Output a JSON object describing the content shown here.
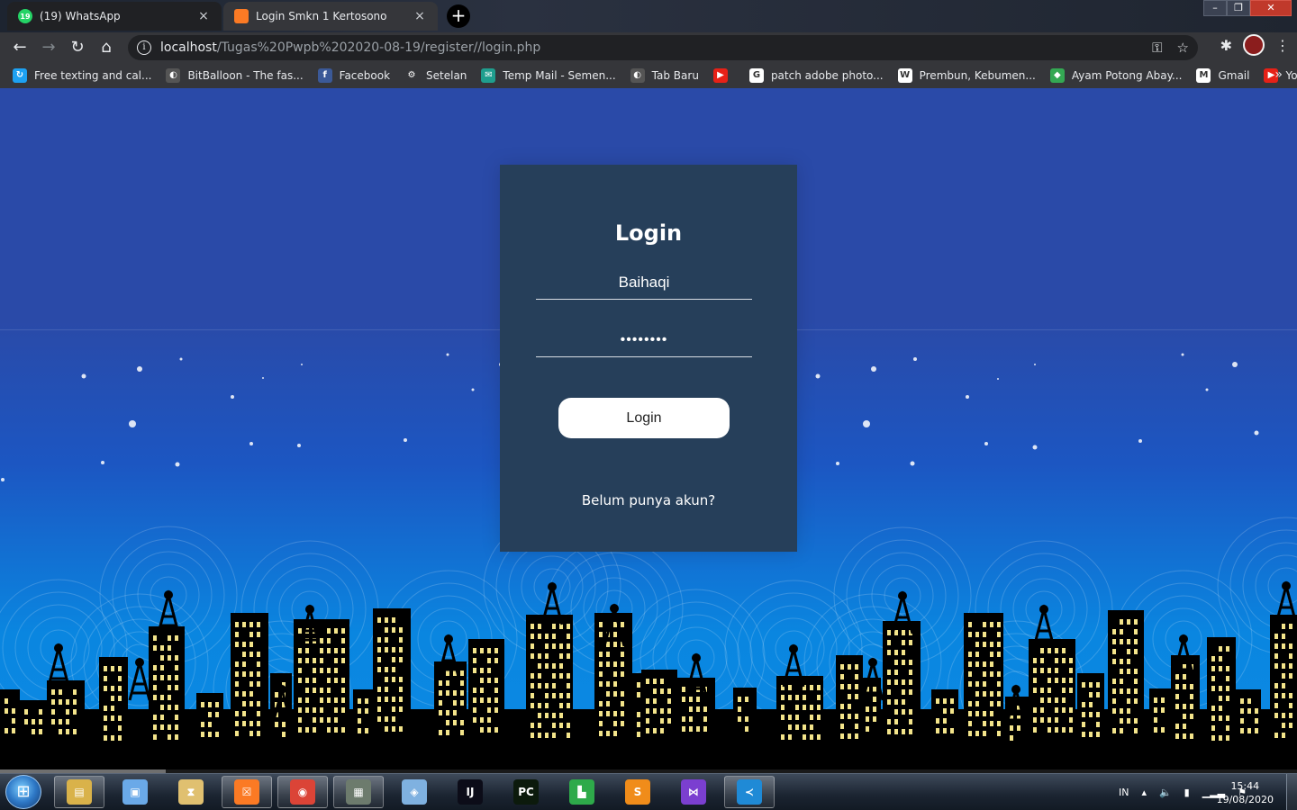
{
  "tabs": [
    {
      "label": "(19) WhatsApp",
      "favicon": "19",
      "close": "×"
    },
    {
      "label": "Login Smkn 1 Kertosono",
      "favicon": "☐",
      "close": "×"
    }
  ],
  "new_tab": "+",
  "omnibox": {
    "host": "localhost",
    "path": "/Tugas%20Pwpb%202020-08-19/register//login.php"
  },
  "bookmarks": [
    {
      "label": "Free texting and cal...",
      "color": "#1da1f2",
      "glyph": "↻"
    },
    {
      "label": "BitBalloon - The fas...",
      "color": "#555",
      "glyph": "◐"
    },
    {
      "label": "Facebook",
      "color": "#3b5998",
      "glyph": "f"
    },
    {
      "label": "Setelan",
      "color": "#35363a",
      "glyph": "⚙"
    },
    {
      "label": "Temp Mail - Semen...",
      "color": "#1f9e8e",
      "glyph": "✉"
    },
    {
      "label": "Tab Baru",
      "color": "#555",
      "glyph": "◐"
    },
    {
      "label": "",
      "color": "#e62117",
      "glyph": "▶"
    },
    {
      "label": "patch adobe photo...",
      "color": "#fff",
      "glyph": "G"
    },
    {
      "label": "Prembun, Kebumen...",
      "color": "#fff",
      "glyph": "W"
    },
    {
      "label": "Ayam Potong Abay...",
      "color": "#34a853",
      "glyph": "◆"
    },
    {
      "label": "Gmail",
      "color": "#fff",
      "glyph": "M"
    },
    {
      "label": "YouTube",
      "color": "#e62117",
      "glyph": "▶"
    }
  ],
  "bookmarks_more": "»",
  "login": {
    "title": "Login",
    "username_value": "Baihaqi",
    "password_value": "••••••••",
    "button_label": "Login",
    "register_link": "Belum punya akun?"
  },
  "colors": {
    "card": "#263f5a",
    "sky_top": "#2a4aa8",
    "sky_bottom": "#0c8ae4"
  },
  "taskbar": {
    "items": [
      {
        "name": "explorer",
        "color": "#d9b24a",
        "glyph": "▤",
        "active": true
      },
      {
        "name": "photos",
        "color": "#6aa9e8",
        "glyph": "▣",
        "active": false
      },
      {
        "name": "hourglass",
        "color": "#e0c070",
        "glyph": "⧗",
        "active": false
      },
      {
        "name": "xampp",
        "color": "#fb7a24",
        "glyph": "☒",
        "active": true
      },
      {
        "name": "chrome",
        "color": "#db4437",
        "glyph": "◉",
        "active": true
      },
      {
        "name": "terminal",
        "color": "#6d7b6d",
        "glyph": "▦",
        "active": true
      },
      {
        "name": "virtualbox",
        "color": "#7fb1e0",
        "glyph": "◈",
        "active": false
      },
      {
        "name": "intellij",
        "color": "#0c0c18",
        "glyph": "IJ",
        "active": false
      },
      {
        "name": "pycharm",
        "color": "#0c1a0c",
        "glyph": "PC",
        "active": false
      },
      {
        "name": "zaitun",
        "color": "#2eaa4a",
        "glyph": "▙",
        "active": false
      },
      {
        "name": "sublime",
        "color": "#f08c1a",
        "glyph": "S",
        "active": false
      },
      {
        "name": "visual-studio",
        "color": "#7b3fd0",
        "glyph": "⋈",
        "active": false
      },
      {
        "name": "vscode",
        "color": "#1f8ad6",
        "glyph": "≺",
        "active": true
      }
    ],
    "language": "IN",
    "time": "15:44",
    "date": "19/08/2020"
  }
}
